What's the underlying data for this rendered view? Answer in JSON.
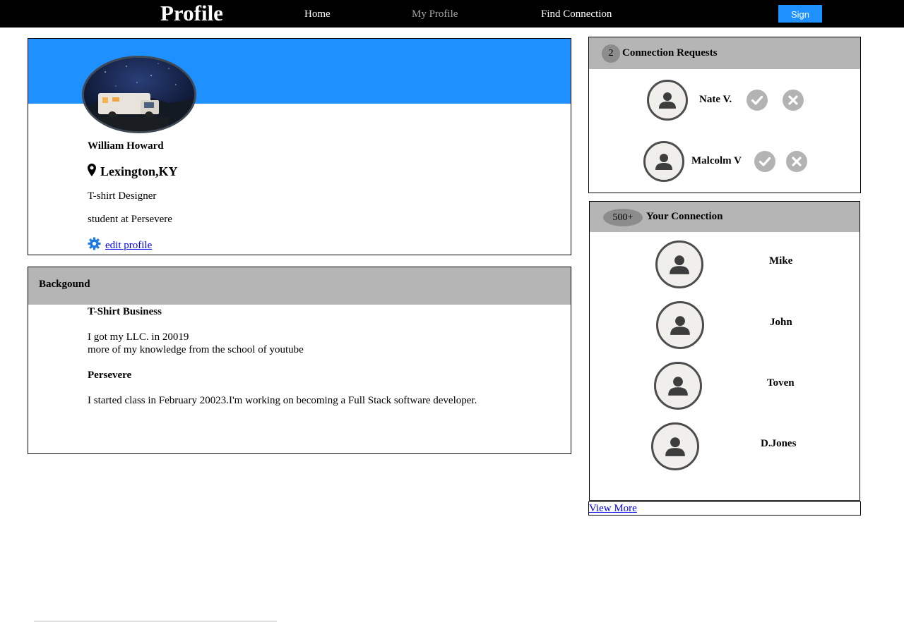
{
  "nav": {
    "brand": "Profile",
    "links": [
      "Home",
      "My Profile",
      "Find Connection"
    ],
    "signout_label": "Sign Out"
  },
  "profile": {
    "name": "William Howard",
    "location": "Lexington,KY",
    "title": "T-shirt Designer",
    "school": "student at Persevere",
    "edit_label": "edit profile",
    "banner_color": "#1e90ff"
  },
  "background": {
    "heading": "Backgound",
    "sections": [
      {
        "title": "T-Shirt Business",
        "lines": [
          "I got my LLC. in 20019",
          "more of my knowledge from the school of youtube"
        ]
      },
      {
        "title": "Persevere",
        "lines": [
          "I started class in February 20023.I'm working on becoming a Full Stack software developer."
        ]
      }
    ]
  },
  "requests": {
    "count": "2",
    "heading": "Connection Requests",
    "items": [
      {
        "name": "Nate V."
      },
      {
        "name": "Malcolm V"
      }
    ]
  },
  "connections": {
    "count": "500+",
    "heading": "Your Connection",
    "items": [
      {
        "name": "Mike"
      },
      {
        "name": "John"
      },
      {
        "name": "Toven"
      },
      {
        "name": "D.Jones"
      }
    ],
    "view_more_label": "View More"
  },
  "colors": {
    "accent": "#1e90ff",
    "header_gray": "#b5b5b5",
    "nav_bg": "#000000"
  }
}
